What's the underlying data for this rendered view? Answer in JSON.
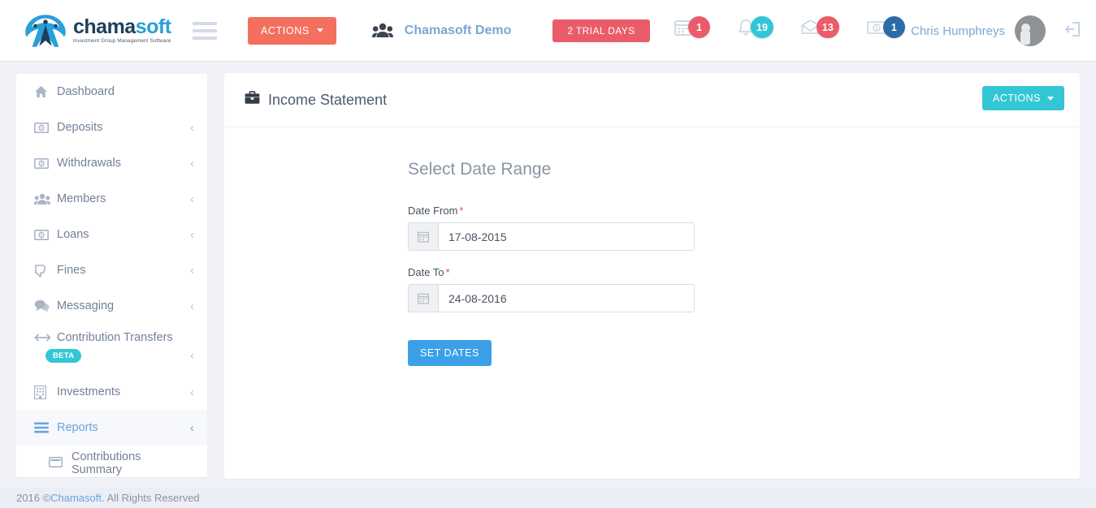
{
  "header": {
    "logo": {
      "word_part1": "chama",
      "word_part2": "soft",
      "tagline": "Investment Group Management Software"
    },
    "menu_toggle_name": "hamburger-icon",
    "actions_label": "ACTIONS",
    "group_name": "Chamasoft Demo",
    "trial_label": "2 TRIAL DAYS",
    "notifications": [
      {
        "icon": "calendar-icon",
        "count": "1",
        "color": "#ea5c6a"
      },
      {
        "icon": "bell-icon",
        "count": "19",
        "color": "#33c7d6"
      },
      {
        "icon": "envelope-icon",
        "count": "13",
        "color": "#ea5c6a"
      },
      {
        "icon": "money-icon",
        "count": "1",
        "color": "#2a6ba8"
      }
    ],
    "user_name": "Chris Humphreys",
    "logout_icon": "sign-out-icon"
  },
  "sidebar": {
    "items": [
      {
        "label": "Dashboard",
        "icon": "home-icon",
        "chevron": "",
        "active": false
      },
      {
        "label": "Deposits",
        "icon": "money-icon",
        "chevron": "‹",
        "active": false
      },
      {
        "label": "Withdrawals",
        "icon": "money-icon",
        "chevron": "‹",
        "active": false
      },
      {
        "label": "Members",
        "icon": "users-icon",
        "chevron": "‹",
        "active": false
      },
      {
        "label": "Loans",
        "icon": "money-icon",
        "chevron": "‹",
        "active": false
      },
      {
        "label": "Fines",
        "icon": "thumbs-down-icon",
        "chevron": "‹",
        "active": false
      },
      {
        "label": "Messaging",
        "icon": "comments-icon",
        "chevron": "‹",
        "active": false
      },
      {
        "label": "Contribution Transfers",
        "icon": "transfer-icon",
        "chevron": "‹",
        "active": false,
        "badge": "BETA"
      },
      {
        "label": "Investments",
        "icon": "building-icon",
        "chevron": "‹",
        "active": false
      },
      {
        "label": "Reports",
        "icon": "bars-icon",
        "chevron": "‹",
        "active": true
      }
    ],
    "submenu_item": {
      "label": "Contributions Summary",
      "icon": "report-icon"
    }
  },
  "panel": {
    "title": "Income Statement",
    "title_icon": "briefcase-icon",
    "actions_label": "ACTIONS",
    "form": {
      "heading": "Select Date Range",
      "date_from_label": "Date From",
      "date_from_value": "17-08-2015",
      "date_from_placeholder": "Date From",
      "date_to_label": "Date To",
      "date_to_value": "24-08-2016",
      "date_to_placeholder": "Date To",
      "required_mark": "*",
      "submit_label": "SET DATES",
      "calendar_icon": "calendar-icon"
    }
  },
  "footer": {
    "prefix": "2016 © ",
    "brand": "Chamasoft",
    "suffix": ". All Rights Reserved"
  },
  "colors": {
    "accent_coral": "#f4705e",
    "accent_teal": "#33c7d6",
    "accent_blue": "#3ba0e8",
    "accent_red": "#ea5c6a",
    "page_bg": "#f1f2f7"
  }
}
